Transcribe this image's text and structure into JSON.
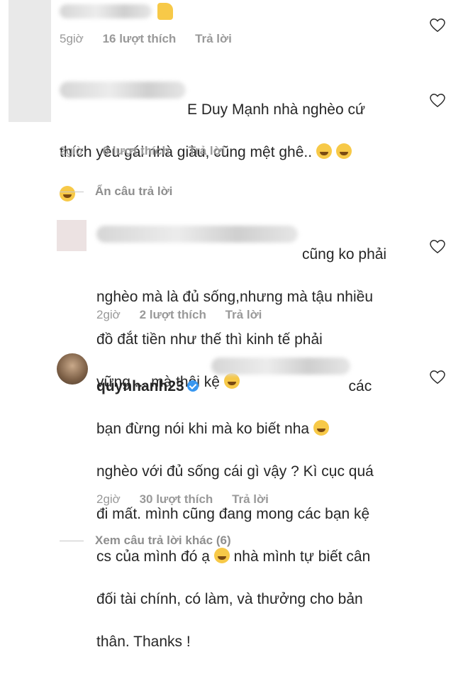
{
  "comments": [
    {
      "text": "",
      "time": "5giờ",
      "likes": "16 lượt thích",
      "reply": "Trả lời"
    },
    {
      "text": "E Duy Mạnh nhà nghèo cứ\nthích yêu gái nhà giàu, cũng mệt ghê..",
      "time": "2giờ",
      "likes": "6 lượt thích",
      "reply": "Trả lời"
    },
    {
      "text": "cũng ko phải\nnghèo mà là đủ sống,nhưng mà tậu nhiều\nđồ đắt tiền như thế thì kinh tế phải\nvững ... mà thôi kệ",
      "time": "2giờ",
      "likes": "2 lượt thích",
      "reply": "Trả lời"
    },
    {
      "username": "quynhanh23",
      "text_tail": "các",
      "text": "bạn đừng nói khi mà ko biết nha\nnghèo với đủ sống cái gì vậy ? Kì cục quá\nđi mất. mình cũng đang mong các bạn kệ\ncs của mình đó ạ     nhà mình tự biết cân\nđối tài chính, có làm, và thưởng cho bản\nthân. Thanks !",
      "time": "2giờ",
      "likes": "30 lượt thích",
      "reply": "Trả lời"
    }
  ],
  "hide_replies": "Ẩn câu trả lời",
  "view_more": "Xem câu trả lời khác (6)",
  "colors": {
    "meta": "#999999",
    "text": "#262626",
    "verified": "#3897f0"
  }
}
